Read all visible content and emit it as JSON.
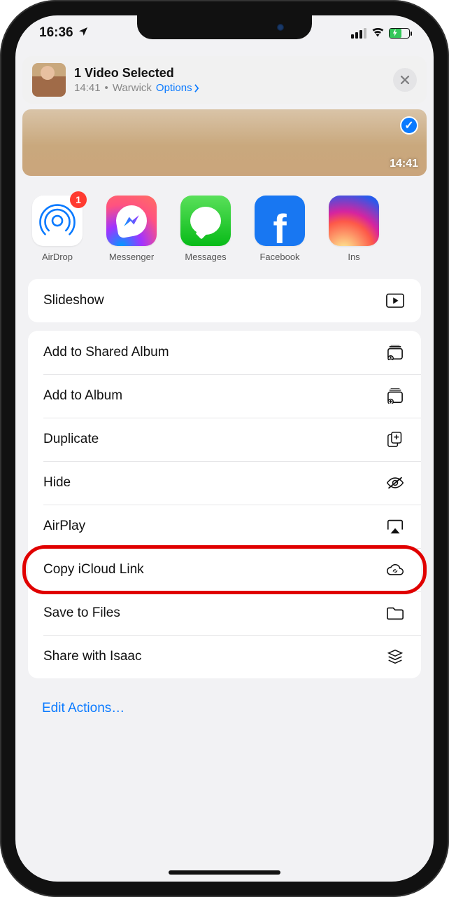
{
  "status": {
    "time": "16:36"
  },
  "header": {
    "title": "1 Video Selected",
    "subtitle_time": "14:41",
    "subtitle_location": "Warwick",
    "options_label": "Options"
  },
  "preview": {
    "selected_time": "14:41"
  },
  "apps": [
    {
      "label": "AirDrop",
      "badge": "1"
    },
    {
      "label": "Messenger"
    },
    {
      "label": "Messages"
    },
    {
      "label": "Facebook"
    },
    {
      "label": "Ins"
    }
  ],
  "actions_top": [
    {
      "label": "Slideshow",
      "icon": "play-rect"
    }
  ],
  "actions": [
    {
      "label": "Add to Shared Album",
      "icon": "shared-album"
    },
    {
      "label": "Add to Album",
      "icon": "add-album"
    },
    {
      "label": "Duplicate",
      "icon": "duplicate"
    },
    {
      "label": "Hide",
      "icon": "eye-slash"
    },
    {
      "label": "AirPlay",
      "icon": "airplay"
    },
    {
      "label": "Copy iCloud Link",
      "icon": "cloud-link",
      "highlighted": true
    },
    {
      "label": "Save to Files",
      "icon": "folder"
    },
    {
      "label": "Share with Isaac",
      "icon": "stack"
    }
  ],
  "edit_actions_label": "Edit Actions…"
}
